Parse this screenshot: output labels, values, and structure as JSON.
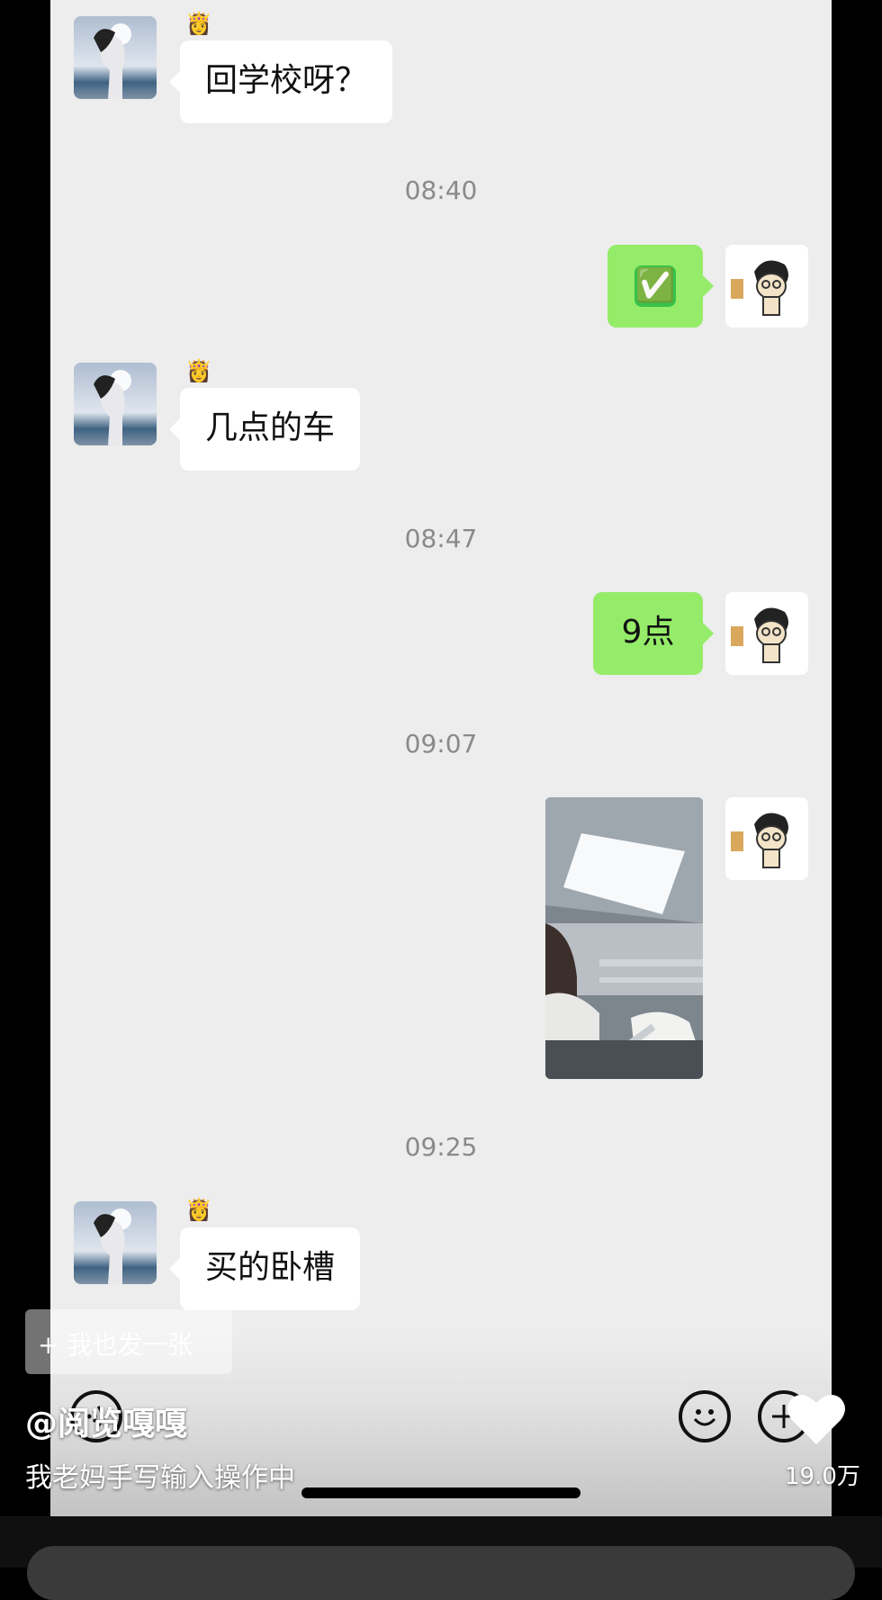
{
  "messages": [
    {
      "from": "partner",
      "text": "回学校呀？"
    },
    {
      "time": "08:40"
    },
    {
      "from": "me",
      "emoji": "✅"
    },
    {
      "from": "partner",
      "text": "几点的车"
    },
    {
      "time": "08:47"
    },
    {
      "from": "me",
      "text": "9点"
    },
    {
      "time": "09:07"
    },
    {
      "from": "me",
      "image": "train-sleeper-photo"
    },
    {
      "time": "09:25"
    },
    {
      "from": "partner",
      "text": "买的卧槽"
    }
  ],
  "partner_badge": "👸",
  "overlay": {
    "post_button": "+ 我也发一张",
    "author": "@阅览嘎嘎",
    "caption": "我老妈手写输入操作中",
    "likes": "19.0万"
  },
  "icons": {
    "voice": "voice-icon",
    "emoji": "emoji-icon",
    "plus": "plus-icon",
    "like": "heart-icon"
  },
  "colors": {
    "chat_bg": "#ededed",
    "out_bubble": "#95ec69",
    "in_bubble": "#ffffff",
    "time_text": "#8a8a8a"
  }
}
